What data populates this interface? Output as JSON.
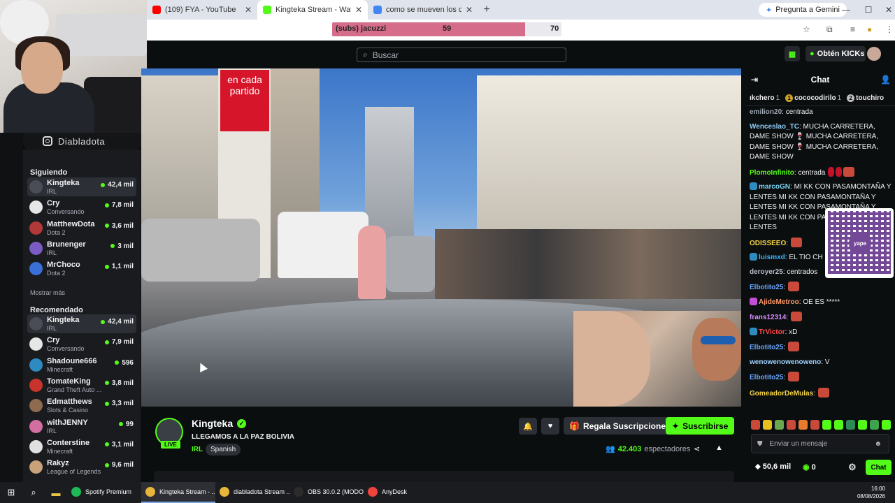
{
  "browser": {
    "tabs": [
      {
        "label": "(109) FYA - YouTube",
        "color": "#ff0000",
        "active": false
      },
      {
        "label": "Kingteka Stream - Watch Live on Kick",
        "color": "#53fc18",
        "active": true
      },
      {
        "label": "como se mueven los carros en",
        "color": "#4285f4",
        "active": false
      }
    ],
    "gemini_label": "Pregunta a Gemini",
    "new_tab": "+"
  },
  "poll": {
    "label": "(subs) jacuzzi",
    "value_a": "59",
    "value_b": "70",
    "fill_fraction": 0.84
  },
  "header": {
    "search_placeholder": "Buscar",
    "kicks_label": "Obtén KICKs"
  },
  "overlay": {
    "instagram_handle": "Diabladota"
  },
  "sidebar": {
    "following_title": "Siguiendo",
    "following": [
      {
        "name": "Kingteka",
        "category": "IRL",
        "viewers": "42,4 mil",
        "color": "#4a4d55",
        "selected": true
      },
      {
        "name": "Cry",
        "category": "Conversando",
        "viewers": "7,8 mil",
        "color": "#e6e6e6",
        "selected": false
      },
      {
        "name": "MatthewDota",
        "category": "Dota 2",
        "viewers": "3,6 mil",
        "color": "#b33939",
        "selected": false
      },
      {
        "name": "Brunenger",
        "category": "IRL",
        "viewers": "3 mil",
        "color": "#7a5cc2",
        "selected": false
      },
      {
        "name": "MrChoco",
        "category": "Dota 2",
        "viewers": "1,1 mil",
        "color": "#3a6fd8",
        "selected": false
      }
    ],
    "show_more": "Mostrar más",
    "recommended_title": "Recomendado",
    "recommended": [
      {
        "name": "Kingteka",
        "category": "IRL",
        "viewers": "42,4 mil",
        "color": "#4a4d55",
        "selected": true
      },
      {
        "name": "Cry",
        "category": "Conversando",
        "viewers": "7,9 mil",
        "color": "#e6e6e6",
        "selected": false
      },
      {
        "name": "Shadoune666",
        "category": "Minecraft",
        "viewers": "596",
        "color": "#2e8bc0",
        "selected": false
      },
      {
        "name": "TomateKing",
        "category": "Grand Theft Auto ...",
        "viewers": "3,8 mil",
        "color": "#c8342b",
        "selected": false
      },
      {
        "name": "Edmatthews",
        "category": "Slots & Casino",
        "viewers": "3,3 mil",
        "color": "#8e6b4f",
        "selected": false
      },
      {
        "name": "withJENNY",
        "category": "IRL",
        "viewers": "99",
        "color": "#d36fa0",
        "selected": false
      },
      {
        "name": "Conterstine",
        "category": "Minecraft",
        "viewers": "3,1 mil",
        "color": "#e0e0e0",
        "selected": false
      },
      {
        "name": "Rakyz",
        "category": "League of Legends",
        "viewers": "9,6 mil",
        "color": "#c9a27a",
        "selected": false
      }
    ]
  },
  "video": {
    "billboard": "en cada partido"
  },
  "stream": {
    "name": "Kingteka",
    "live_label": "LIVE",
    "title": "LLEGAMOS A LA PAZ BOLIVIA",
    "category": "IRL",
    "tag": "Spanish",
    "gift_label": "Regala Suscripciones",
    "subscribe_label": "Suscribirse",
    "viewers": "42.403",
    "viewers_label": "espectadores"
  },
  "chat": {
    "title": "Chat",
    "leaderboard": [
      {
        "name": "ıkchero",
        "count": "1",
        "rank": ""
      },
      {
        "name": "cococodirilo",
        "count": "1",
        "rank": "1"
      },
      {
        "name": "touchiro",
        "count": "",
        "rank": "2"
      }
    ],
    "messages": [
      {
        "user": "emilion20",
        "color": "#9ea7b3",
        "text": "centrada",
        "badge": ""
      },
      {
        "user": "Wenceslao_TC",
        "color": "#8ecbf5",
        "text": "MUCHA CARRETERA, DAME SHOW 🍷 MUCHA CARRETERA, DAME SHOW 🍷 MUCHA CARRETERA, DAME SHOW",
        "badge": ""
      },
      {
        "user": "PlomoInfinito",
        "color": "#53fc18",
        "text": "centrada",
        "badge": ""
      },
      {
        "user": "marcoGN",
        "color": "#7ad3f5",
        "text": "MI KK CON PASAMONTAÑA Y LENTES MI KK CON PASAMONTAÑA Y LENTES MI KK CON PASAMONTAÑA Y LENTES MI KK CON PASAMONTAÑA Y LENTES",
        "badge": "#2e8bc0"
      },
      {
        "user": "ODISSEEO",
        "color": "#f5d547",
        "text": "",
        "badge": ""
      },
      {
        "user": "luismxd",
        "color": "#38b6ff",
        "text": "EL TIO CH",
        "badge": "#2e8bc0"
      },
      {
        "user": "deroyer25",
        "color": "#bcbcc8",
        "text": "centrados",
        "badge": ""
      },
      {
        "user": "Elbotito25",
        "color": "#6aa8ff",
        "text": "",
        "badge": ""
      },
      {
        "user": "AjideMetroo",
        "color": "#ff9a6a",
        "text": "OE ES *****",
        "badge": "#c44fd6"
      },
      {
        "user": "frans12314",
        "color": "#d68cff",
        "text": "",
        "badge": ""
      },
      {
        "user": "TrVictor",
        "color": "#ff4a4a",
        "text": "xD",
        "badge": "#2e8bc0"
      },
      {
        "user": "Elbotito25",
        "color": "#6aa8ff",
        "text": "",
        "badge": ""
      },
      {
        "user": "wenowenowenoweno",
        "color": "#9fd1ff",
        "text": "V",
        "badge": ""
      },
      {
        "user": "Elbotito25",
        "color": "#6aa8ff",
        "text": "",
        "badge": ""
      },
      {
        "user": "GomeadorDeMulas",
        "color": "#f5d547",
        "text": "",
        "badge": ""
      }
    ],
    "qr_brand": "yape",
    "input_placeholder": "Enviar un mensaje",
    "points": "50,6 mil",
    "kicks": "0",
    "chat_button": "Chat"
  },
  "taskbar": {
    "apps": [
      {
        "label": "Spotify Premium",
        "color": "#1db954",
        "active": false
      },
      {
        "label": "Kingteka Stream - ...",
        "color": "#e8b63a",
        "active": true
      },
      {
        "label": "diabladota Stream ...",
        "color": "#e8b63a",
        "active": false
      },
      {
        "label": "OBS 30.0.2 (MODO ...",
        "color": "#2b2b2b",
        "active": false
      },
      {
        "label": "AnyDesk",
        "color": "#ef443b",
        "active": false
      }
    ],
    "time": "16:00",
    "date": "08/08/2026"
  }
}
